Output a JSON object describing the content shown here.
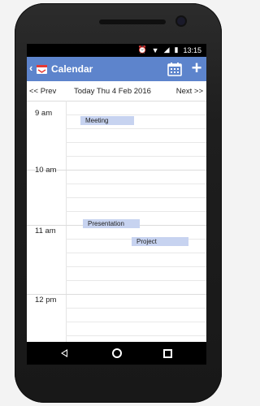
{
  "status": {
    "time": "13:15"
  },
  "app": {
    "title": "Calendar",
    "back_glyph": "‹",
    "add_glyph": "+"
  },
  "nav": {
    "prev": "<< Prev",
    "date": "Today Thu 4 Feb 2016",
    "next": "Next >>"
  },
  "hours": [
    "9 am",
    "10 am",
    "11 am",
    "12 pm"
  ],
  "events": [
    {
      "title": "Meeting"
    },
    {
      "title": "Presentation"
    },
    {
      "title": "Project"
    }
  ],
  "icons": {
    "calendar": "calendar-icon",
    "add": "add-icon",
    "back": "back-arrow-icon"
  },
  "colors": {
    "appbar": "#5d84cc",
    "event": "#c7d3f0"
  }
}
